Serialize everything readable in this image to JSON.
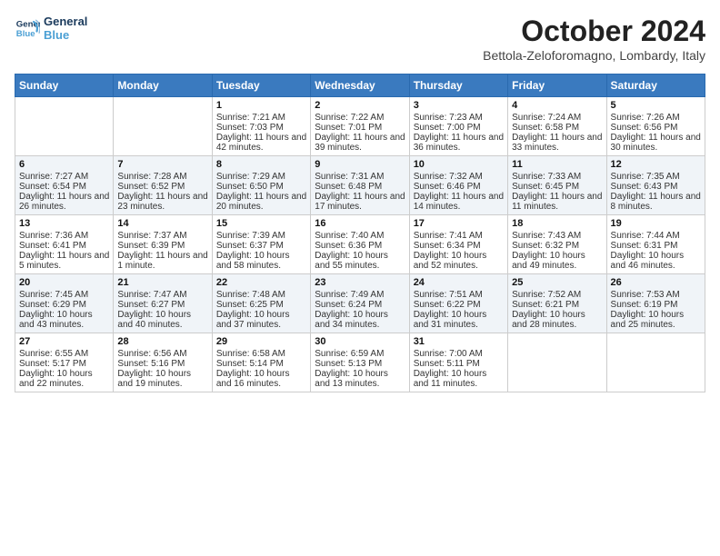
{
  "header": {
    "logo_line1": "General",
    "logo_line2": "Blue",
    "month": "October 2024",
    "location": "Bettola-Zeloforomagno, Lombardy, Italy"
  },
  "days_of_week": [
    "Sunday",
    "Monday",
    "Tuesday",
    "Wednesday",
    "Thursday",
    "Friday",
    "Saturday"
  ],
  "weeks": [
    [
      {
        "day": "",
        "content": ""
      },
      {
        "day": "",
        "content": ""
      },
      {
        "day": "1",
        "content": "Sunrise: 7:21 AM\nSunset: 7:03 PM\nDaylight: 11 hours and 42 minutes."
      },
      {
        "day": "2",
        "content": "Sunrise: 7:22 AM\nSunset: 7:01 PM\nDaylight: 11 hours and 39 minutes."
      },
      {
        "day": "3",
        "content": "Sunrise: 7:23 AM\nSunset: 7:00 PM\nDaylight: 11 hours and 36 minutes."
      },
      {
        "day": "4",
        "content": "Sunrise: 7:24 AM\nSunset: 6:58 PM\nDaylight: 11 hours and 33 minutes."
      },
      {
        "day": "5",
        "content": "Sunrise: 7:26 AM\nSunset: 6:56 PM\nDaylight: 11 hours and 30 minutes."
      }
    ],
    [
      {
        "day": "6",
        "content": "Sunrise: 7:27 AM\nSunset: 6:54 PM\nDaylight: 11 hours and 26 minutes."
      },
      {
        "day": "7",
        "content": "Sunrise: 7:28 AM\nSunset: 6:52 PM\nDaylight: 11 hours and 23 minutes."
      },
      {
        "day": "8",
        "content": "Sunrise: 7:29 AM\nSunset: 6:50 PM\nDaylight: 11 hours and 20 minutes."
      },
      {
        "day": "9",
        "content": "Sunrise: 7:31 AM\nSunset: 6:48 PM\nDaylight: 11 hours and 17 minutes."
      },
      {
        "day": "10",
        "content": "Sunrise: 7:32 AM\nSunset: 6:46 PM\nDaylight: 11 hours and 14 minutes."
      },
      {
        "day": "11",
        "content": "Sunrise: 7:33 AM\nSunset: 6:45 PM\nDaylight: 11 hours and 11 minutes."
      },
      {
        "day": "12",
        "content": "Sunrise: 7:35 AM\nSunset: 6:43 PM\nDaylight: 11 hours and 8 minutes."
      }
    ],
    [
      {
        "day": "13",
        "content": "Sunrise: 7:36 AM\nSunset: 6:41 PM\nDaylight: 11 hours and 5 minutes."
      },
      {
        "day": "14",
        "content": "Sunrise: 7:37 AM\nSunset: 6:39 PM\nDaylight: 11 hours and 1 minute."
      },
      {
        "day": "15",
        "content": "Sunrise: 7:39 AM\nSunset: 6:37 PM\nDaylight: 10 hours and 58 minutes."
      },
      {
        "day": "16",
        "content": "Sunrise: 7:40 AM\nSunset: 6:36 PM\nDaylight: 10 hours and 55 minutes."
      },
      {
        "day": "17",
        "content": "Sunrise: 7:41 AM\nSunset: 6:34 PM\nDaylight: 10 hours and 52 minutes."
      },
      {
        "day": "18",
        "content": "Sunrise: 7:43 AM\nSunset: 6:32 PM\nDaylight: 10 hours and 49 minutes."
      },
      {
        "day": "19",
        "content": "Sunrise: 7:44 AM\nSunset: 6:31 PM\nDaylight: 10 hours and 46 minutes."
      }
    ],
    [
      {
        "day": "20",
        "content": "Sunrise: 7:45 AM\nSunset: 6:29 PM\nDaylight: 10 hours and 43 minutes."
      },
      {
        "day": "21",
        "content": "Sunrise: 7:47 AM\nSunset: 6:27 PM\nDaylight: 10 hours and 40 minutes."
      },
      {
        "day": "22",
        "content": "Sunrise: 7:48 AM\nSunset: 6:25 PM\nDaylight: 10 hours and 37 minutes."
      },
      {
        "day": "23",
        "content": "Sunrise: 7:49 AM\nSunset: 6:24 PM\nDaylight: 10 hours and 34 minutes."
      },
      {
        "day": "24",
        "content": "Sunrise: 7:51 AM\nSunset: 6:22 PM\nDaylight: 10 hours and 31 minutes."
      },
      {
        "day": "25",
        "content": "Sunrise: 7:52 AM\nSunset: 6:21 PM\nDaylight: 10 hours and 28 minutes."
      },
      {
        "day": "26",
        "content": "Sunrise: 7:53 AM\nSunset: 6:19 PM\nDaylight: 10 hours and 25 minutes."
      }
    ],
    [
      {
        "day": "27",
        "content": "Sunrise: 6:55 AM\nSunset: 5:17 PM\nDaylight: 10 hours and 22 minutes."
      },
      {
        "day": "28",
        "content": "Sunrise: 6:56 AM\nSunset: 5:16 PM\nDaylight: 10 hours and 19 minutes."
      },
      {
        "day": "29",
        "content": "Sunrise: 6:58 AM\nSunset: 5:14 PM\nDaylight: 10 hours and 16 minutes."
      },
      {
        "day": "30",
        "content": "Sunrise: 6:59 AM\nSunset: 5:13 PM\nDaylight: 10 hours and 13 minutes."
      },
      {
        "day": "31",
        "content": "Sunrise: 7:00 AM\nSunset: 5:11 PM\nDaylight: 10 hours and 11 minutes."
      },
      {
        "day": "",
        "content": ""
      },
      {
        "day": "",
        "content": ""
      }
    ]
  ]
}
